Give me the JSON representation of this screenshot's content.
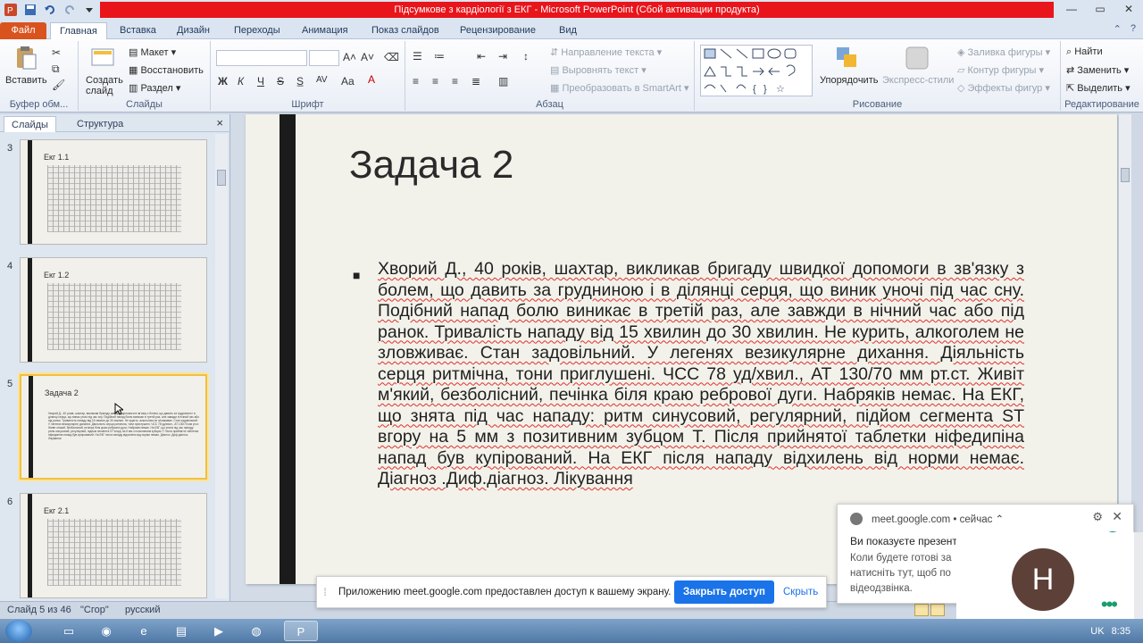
{
  "window": {
    "title": "Підсумкове з кардіології з ЕКГ  -  Microsoft PowerPoint (Сбой активации продукта)",
    "controls": {
      "minimize": "—",
      "maximize": "▭",
      "close": "✕"
    }
  },
  "ribbon_tabs": {
    "file": "Файл",
    "items": [
      "Главная",
      "Вставка",
      "Дизайн",
      "Переходы",
      "Анимация",
      "Показ слайдов",
      "Рецензирование",
      "Вид"
    ],
    "active": "Главная"
  },
  "ribbon": {
    "clipboard": {
      "paste": "Вставить",
      "label": "Буфер обм..."
    },
    "slides": {
      "new_slide": "Создать слайд",
      "layout": "Макет",
      "reset": "Восстановить",
      "section": "Раздел",
      "label": "Слайды"
    },
    "font": {
      "bold": "Ж",
      "italic": "К",
      "underline": "Ч",
      "strike": "S",
      "spacing": "AV",
      "case": "Aa",
      "label": "Шрифт"
    },
    "paragraph": {
      "text_direction": "Направление текста",
      "align_text": "Выровнять текст",
      "smartart": "Преобразовать в SmartArt",
      "label": "Абзац"
    },
    "drawing": {
      "arrange": "Упорядочить",
      "quick_styles": "Экспресс-стили",
      "shape_fill": "Заливка фигуры",
      "shape_outline": "Контур фигуры",
      "shape_effects": "Эффекты фигур",
      "label": "Рисование"
    },
    "editing": {
      "find": "Найти",
      "replace": "Заменить",
      "select": "Выделить",
      "label": "Редактирование"
    }
  },
  "left_pane": {
    "tab_slides": "Слайды",
    "tab_outline": "Структура",
    "close": "×",
    "thumbnails": [
      {
        "number": "3",
        "title": "Екг 1.1",
        "kind": "ecg"
      },
      {
        "number": "4",
        "title": "Екг 1.2",
        "kind": "ecg"
      },
      {
        "number": "5",
        "title": "Задача 2",
        "kind": "text",
        "selected": true
      },
      {
        "number": "6",
        "title": "Екг 2.1",
        "kind": "ecg"
      }
    ],
    "thumb_text": "Хворий Д., 40 років, шахтар, викликав бригаду швидкої допомоги в зв'язку з болем, що давить за грудниною і в ділянці серця, що виник уночі під час сну. Подібний напад болю виникає в третій раз, але завжди в нічний час або під ранок. Тривалість нападу від 15 хвилин до 30 хвилин. Не курить, алкоголем не зловживає. Стан задовільний. У легенях везикулярне дихання. Діяльність серця ритмічна, тони приглушені. ЧСС 78 уд/хвил., АТ 130/70 мм рт.ст. Живіт м'який, безболісний, печінка біля краю ребрової дуги. Набряків немає. На ЕКГ, що знята під час нападу: ритм синусовий, регулярний, підйом сегмента ST вгору на 5 мм з позитивним зубцом Т. Після прийнятої таблетки ніфедипіна напад був купірований. На ЕКГ після нападу відхилень від норми немає. Діагноз .Диф.діагноз. Лікування"
  },
  "slide": {
    "title": "Задача 2",
    "bullet": "■",
    "body": "Хворий Д., 40 років, шахтар, викликав бригаду швидкої допомоги в зв'язку з болем, що давить за грудниною і в ділянці серця, що виник уночі під час сну. Подібний напад болю виникає в третій раз, але завжди в нічний час або під ранок. Тривалість нападу від 15 хвилин до 30 хвилин. Не курить, алкоголем не зловживає. Стан задовільний. У легенях везикулярне дихання. Діяльність серця ритмічна, тони приглушені. ЧСС 78 уд/хвил., АТ 130/70 мм рт.ст. Живіт м'який, безболісний, печінка біля краю ребрової дуги. Набряків немає. На ЕКГ, що знята під час нападу: ритм синусовий, регулярний, підйом сегмента ST вгору на 5 мм з позитивним зубцом Т. Після прийнятої таблетки ніфедипіна напад був купірований. На ЕКГ після нападу відхилень від норми немає. Діагноз .Диф.діагноз. Лікування"
  },
  "share_bar": {
    "message": "Приложению meet.google.com предоставлен доступ к вашему экрану.",
    "stop": "Закрыть доступ",
    "hide": "Скрыть"
  },
  "notification": {
    "source": "meet.google.com",
    "time": "• сейчас ⌃",
    "title": "Ви показуєте презент",
    "message": "Коли будете готові за\nнатисніть тут, щоб по\nвідеодзвінка."
  },
  "avatar": {
    "initial": "H",
    "more": "•••"
  },
  "statusbar": {
    "slide_info": "Слайд 5 из 46",
    "theme": "\"Сгор\"",
    "language": "русский"
  },
  "taskbar": {
    "tray_lang": "UK",
    "clock": "8:35"
  },
  "colors": {
    "title_bar_warning": "#e8151b",
    "file_tab": "#d9531e",
    "share_button": "#1a73e8",
    "avatar_bg": "#5d4037",
    "selected_thumb": "#f0c040"
  }
}
